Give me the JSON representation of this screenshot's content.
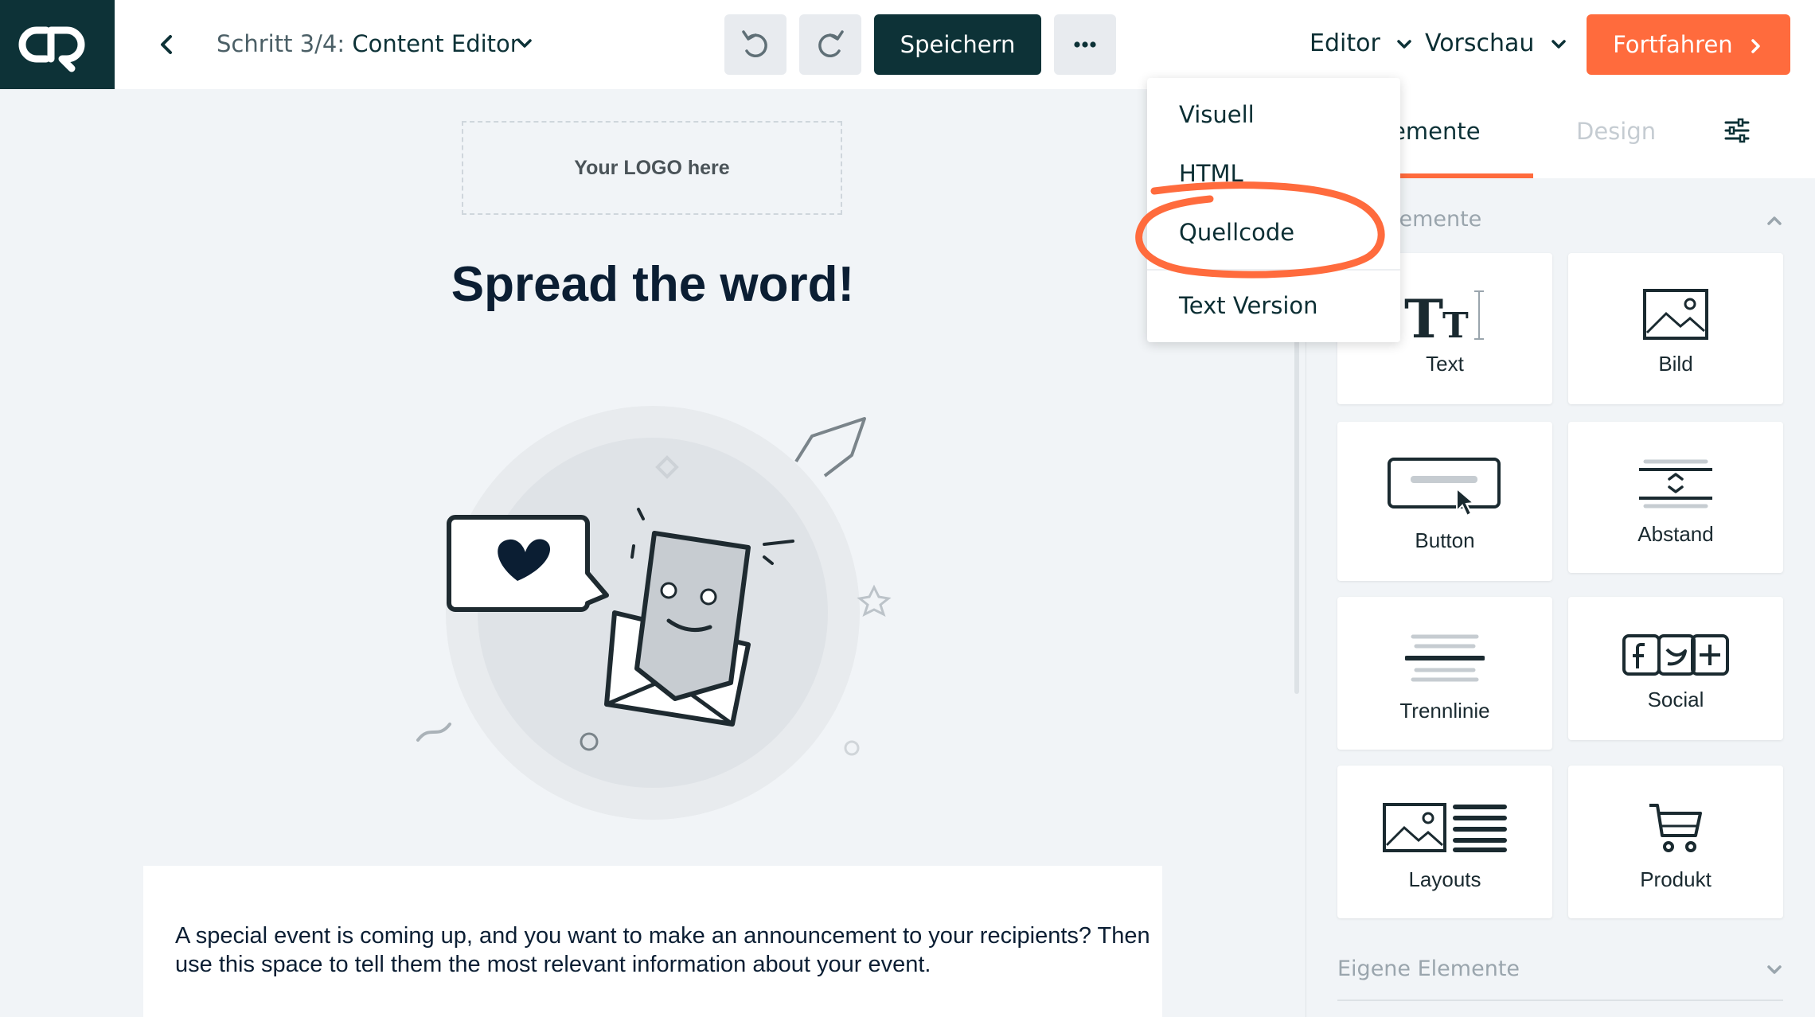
{
  "header": {
    "step_prefix": "Schritt 3/4:",
    "step_title": "Content Editor",
    "save_label": "Speichern",
    "editor_label": "Editor",
    "preview_label": "Vorschau",
    "continue_label": "Fortfahren",
    "icons": [
      "back-arrow-icon",
      "chevron-down-icon",
      "undo-icon",
      "redo-icon",
      "more-icon",
      "chevron-right-icon"
    ]
  },
  "canvas": {
    "logo_placeholder": "Your LOGO here",
    "headline": "Spread the word!",
    "body_text": "A special event is coming up, and you want to make an announcement to your recipients? Then use this space to tell them the most relevant information about your event."
  },
  "panel": {
    "tab_elements": "lemente",
    "tab_design": "Design",
    "section_standard": "ard Elemente",
    "section_own": "Eigene Elemente",
    "tiles": [
      {
        "label": "Text",
        "icon": "text-icon"
      },
      {
        "label": "Bild",
        "icon": "image-icon"
      },
      {
        "label": "Button",
        "icon": "button-icon"
      },
      {
        "label": "Abstand",
        "icon": "spacing-icon"
      },
      {
        "label": "Trennlinie",
        "icon": "divider-icon"
      },
      {
        "label": "Social",
        "icon": "social-icon"
      },
      {
        "label": "Layouts",
        "icon": "layouts-icon"
      },
      {
        "label": "Produkt",
        "icon": "cart-icon"
      }
    ]
  },
  "dropdown": {
    "items": [
      "Visuell",
      "HTML",
      "Quellcode",
      "Text Version"
    ],
    "highlighted": "Quellcode"
  },
  "colors": {
    "brand_dark": "#0d3237",
    "accent_orange": "#ff6b3d",
    "canvas_bg": "#f1f4f7"
  }
}
